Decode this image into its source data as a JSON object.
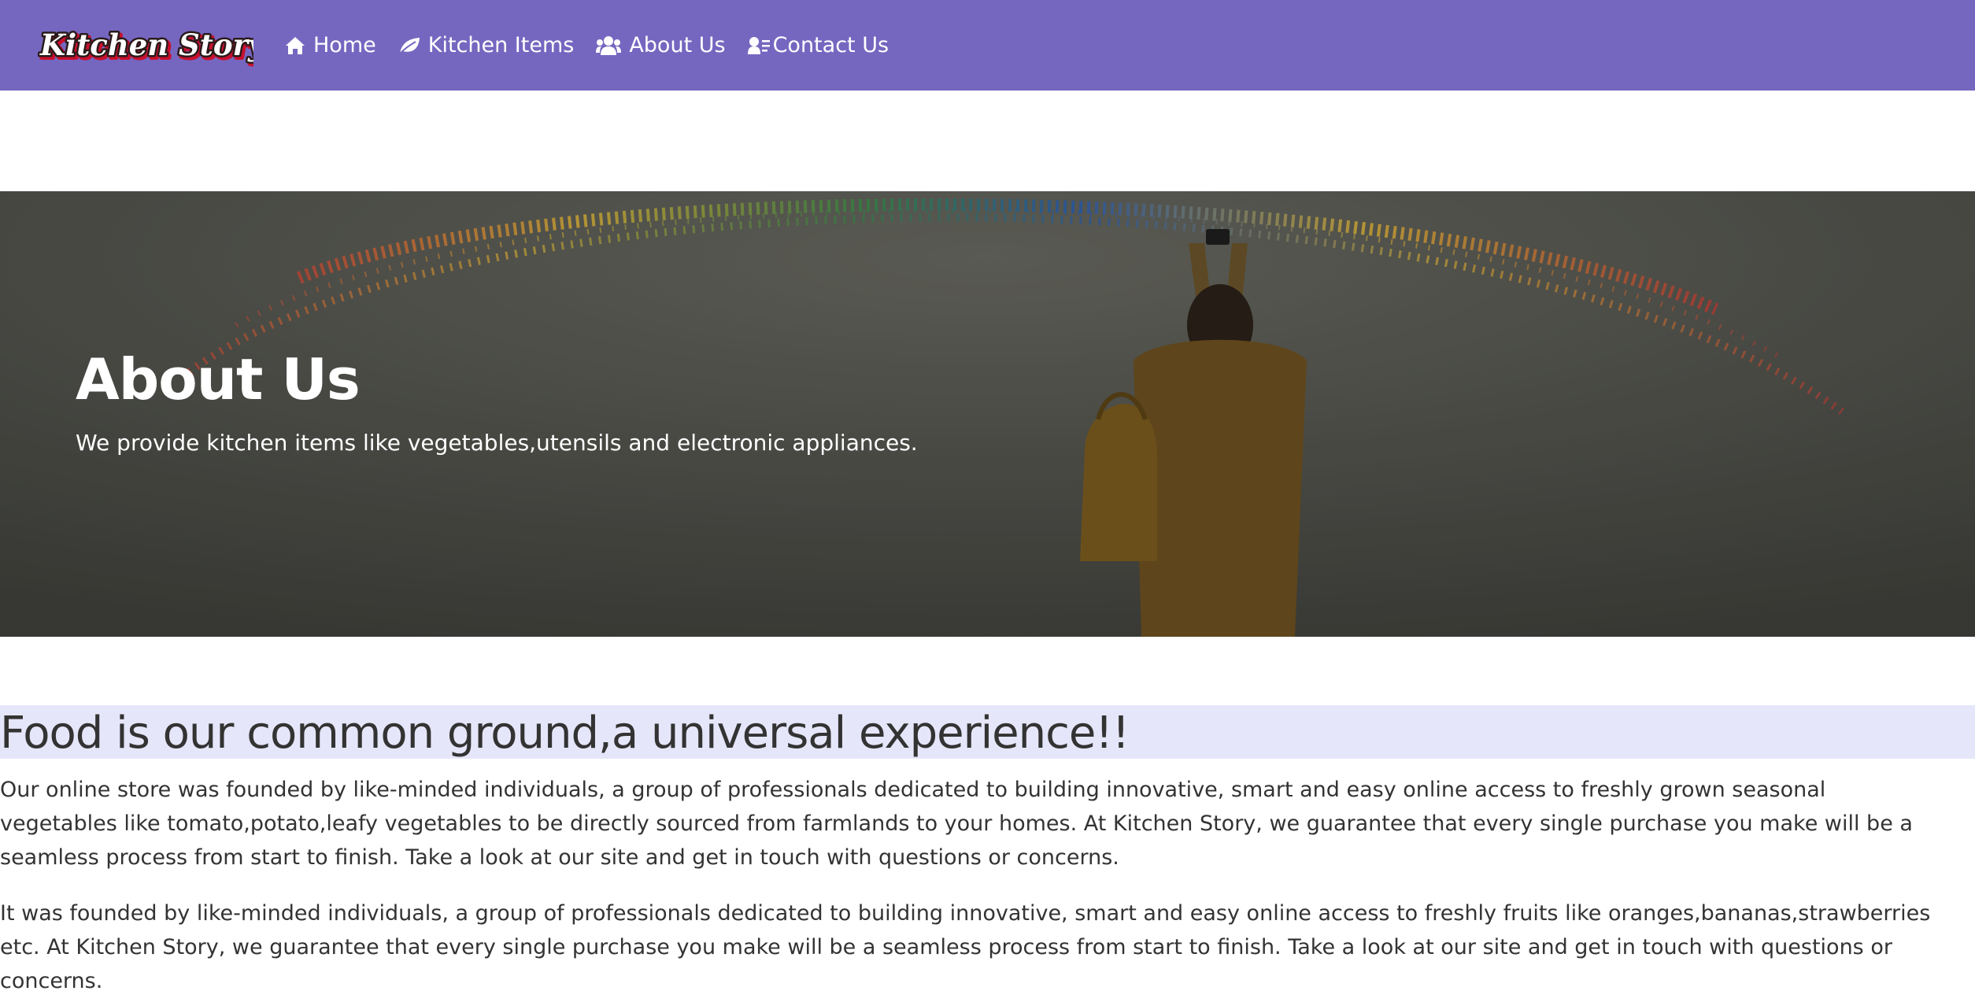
{
  "navbar": {
    "brand": "Kitchen Story",
    "background_color": "#7567c0",
    "items": [
      {
        "label": "Home",
        "icon": "home-icon"
      },
      {
        "label": "Kitchen Items",
        "icon": "leaf-icon"
      },
      {
        "label": "About Us",
        "icon": "users-icon"
      },
      {
        "label": "Contact Us",
        "icon": "user-list-icon"
      }
    ]
  },
  "hero": {
    "title": "About Us",
    "text": "We provide kitchen items like vegetables,utensils and electronic appliances."
  },
  "main": {
    "heading": "Food is our common ground,a universal experience!!",
    "heading_background": "#e6e6fa",
    "paragraphs": [
      "Our online store was founded by like-minded individuals, a group of professionals dedicated to building innovative, smart and easy online access to freshly grown seasonal vegetables like tomato,potato,leafy vegetables to be directly sourced from farmlands to your homes. At Kitchen Story, we guarantee that every single purchase you make will be a seamless process from start to finish. Take a look at our site and get in touch with questions or concerns.",
      "It was founded by like-minded individuals, a group of professionals dedicated to building innovative, smart and easy online access to freshly fruits like oranges,bananas,strawberries etc. At Kitchen Story, we guarantee that every single purchase you make will be a seamless process from start to finish. Take a look at our site and get in touch with questions or concerns."
    ]
  }
}
